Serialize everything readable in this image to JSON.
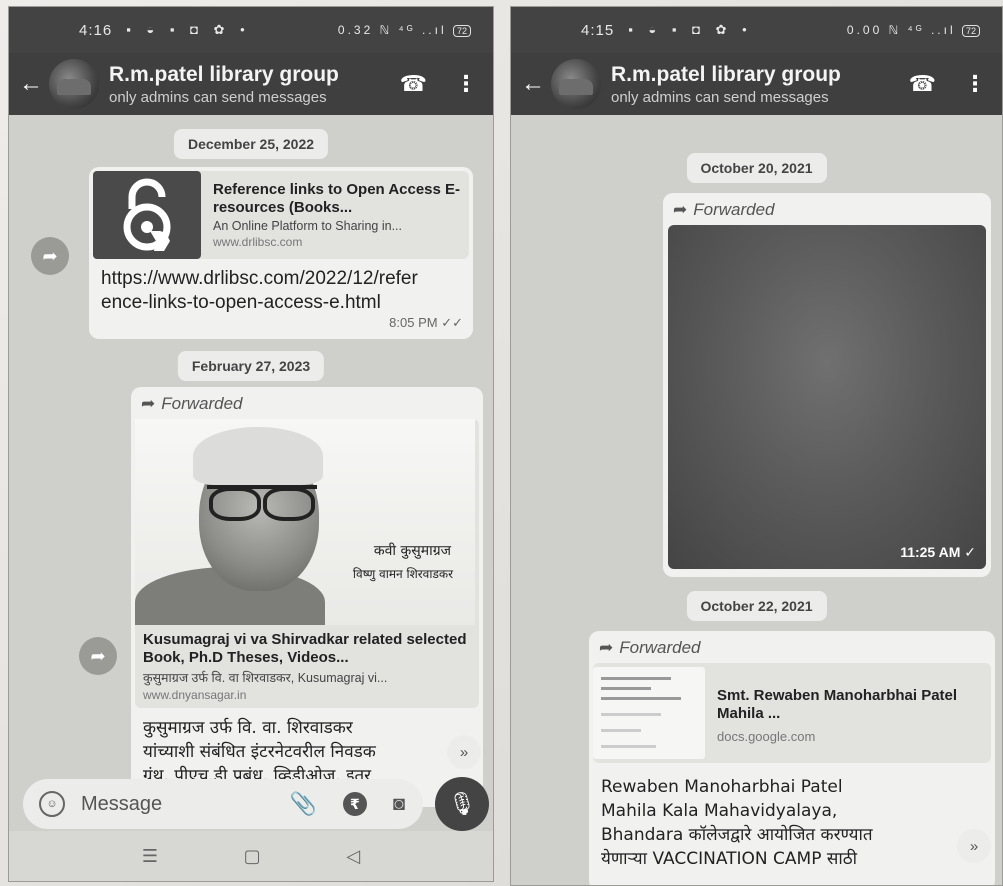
{
  "left": {
    "status": {
      "time": "4:16",
      "icons": "▪ ◒ ▪ ◘ ✿ •",
      "right": "0.32 ℕ ⁴ᴳ ..ıl",
      "battery": "72"
    },
    "header": {
      "title": "R.m.patel library group",
      "subtitle": "only admins can send messages"
    },
    "dates": [
      "December 25, 2022",
      "February 27, 2023"
    ],
    "msg1": {
      "preview_title": "Reference links to Open Access E-resources (Books...",
      "preview_desc": "An Online Platform to Sharing in...",
      "preview_url": "www.drlibsc.com",
      "text": "https://www.drlibsc.com/2022/12/reference-links-to-open-access-e.html",
      "time": "8:05 PM",
      "ticks": "✓✓"
    },
    "msg2": {
      "forwarded": "Forwarded",
      "image_caption_1": "कवी कुसुमाग्रज",
      "image_caption_2": "विष्णु वामन शिरवाडकर",
      "preview_title": "Kusumagraj vi va Shirvadkar related selected Book, Ph.D Theses, Videos...",
      "preview_desc": "कुसुमाग्रज उर्फ वि. वा शिरवाडकर, Kusumagraj vi...",
      "preview_url": "www.dnyansagar.in",
      "text_line1": "कुसुमाग्रज उर्फ वि. वा. शिरवाडकर",
      "text_line2": "यांच्याशी संबंधित इंटरनेटवरील निवडक",
      "text_line3": "ग्रंथ, पीएच.डी प्रबंध, व्हिडीओज, इतर"
    },
    "input": {
      "placeholder": "Message"
    },
    "nav": {
      "menu": "☰",
      "home": "▢",
      "back": "◁"
    }
  },
  "right": {
    "status": {
      "time": "4:15",
      "icons": "▪ ◒ ▪ ◘ ✿ •",
      "right": "0.00 ℕ ⁴ᴳ ..ıl",
      "battery": "72"
    },
    "header": {
      "title": "R.m.patel library group",
      "subtitle": "only admins can send messages"
    },
    "dates": [
      "October 20, 2021",
      "October 22, 2021"
    ],
    "msg1": {
      "forwarded": "Forwarded",
      "time": "11:25 AM",
      "ticks": "✓"
    },
    "msg2": {
      "forwarded": "Forwarded",
      "preview_title": "Smt. Rewaben Manoharbhai Patel Mahila ...",
      "preview_url": "docs.google.com",
      "text_line1": "Rewaben Manoharbhai Patel",
      "text_line2": "Mahila Kala Mahavidyalaya,",
      "text_line3": "Bhandara कॉलेजद्वारे आयोजित करण्यात",
      "text_line4": "येणाऱ्या VACCINATION CAMP साठी"
    }
  },
  "icons": {
    "back": "←",
    "call_add": "☎",
    "more": "⋮",
    "share": "➦",
    "forward": "➦",
    "scroll_down": "»",
    "clip": "📎",
    "rupee": "₹",
    "camera": "◙",
    "mic": "🎙",
    "emoji": "☺"
  }
}
